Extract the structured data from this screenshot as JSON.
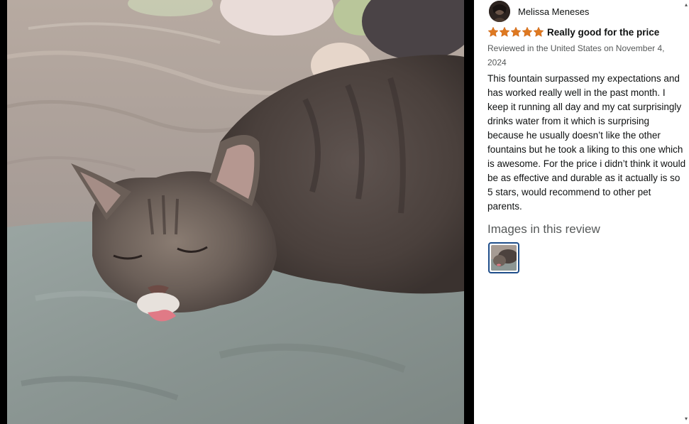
{
  "review": {
    "author": "Melissa Meneses",
    "rating": 5,
    "rating_max": 5,
    "title": "Really good for the price",
    "meta": "Reviewed in the United States on November 4, 2024",
    "body": "This fountain surpassed my expectations and has worked really well in the past month. I keep it running all day and my cat surprisingly drinks water from it which is surprising because he usually doesn’t like the other fountains but he took a liking to this one which is awesome. For the price i didn’t think it would be as effective and durable as it actually is so 5 stars, would recommend to other pet parents.",
    "images_heading": "Images in this review"
  },
  "colors": {
    "star": "#de7921",
    "star_outline": "#e47911",
    "thumb_border": "#1f4e8a",
    "viewer_bg": "#000000"
  },
  "icons": {
    "star": "star-icon",
    "scroll_up": "chevron-up-icon",
    "scroll_down": "chevron-down-icon"
  }
}
